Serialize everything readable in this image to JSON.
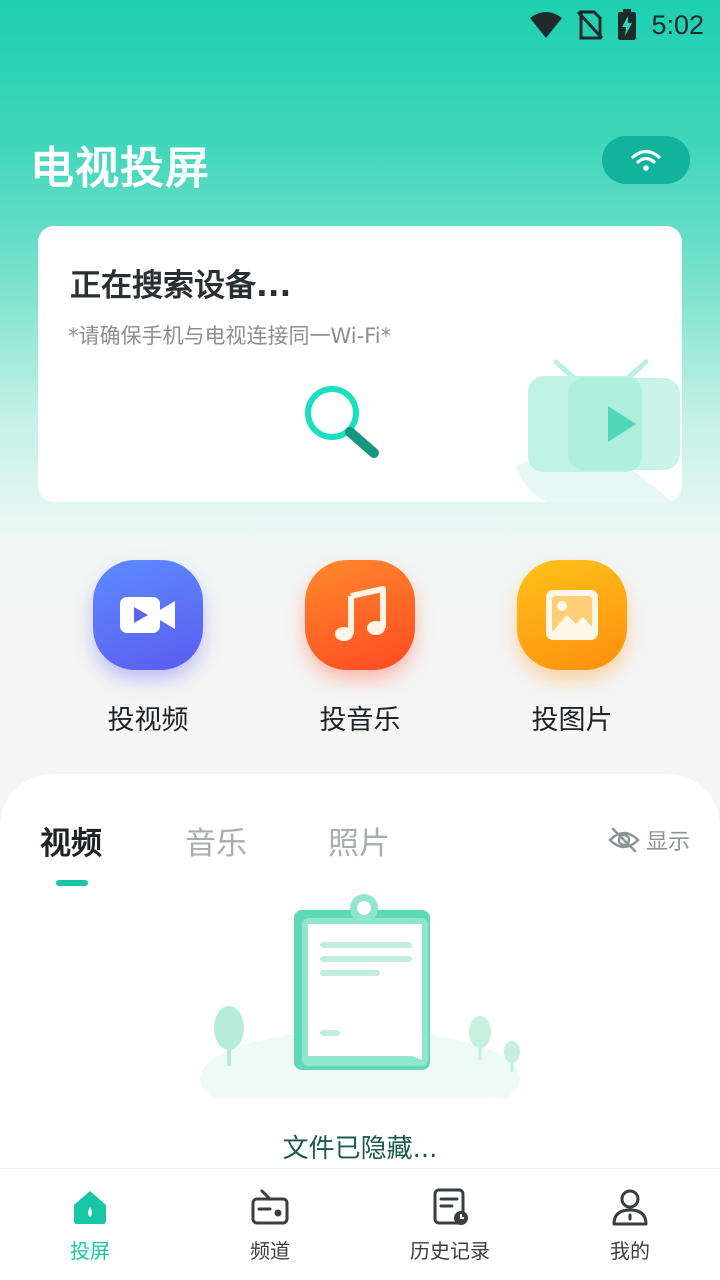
{
  "status_bar": {
    "time": "5:02"
  },
  "header": {
    "title": "电视投屏"
  },
  "search_card": {
    "title": "正在搜索设备...",
    "hint": "*请确保手机与电视连接同一Wi-Fi*"
  },
  "actions": [
    {
      "label": "投视频",
      "icon": "video-camera-icon",
      "color": "#5b6ef7"
    },
    {
      "label": "投音乐",
      "icon": "music-note-icon",
      "color": "#ff6a2a"
    },
    {
      "label": "投图片",
      "icon": "image-icon",
      "color": "#ffa812"
    }
  ],
  "media_tabs": {
    "tabs": [
      "视频",
      "音乐",
      "照片"
    ],
    "active_index": 0,
    "show_toggle": "显示"
  },
  "empty_state": {
    "message": "文件已隐藏..."
  },
  "bottom_nav": {
    "items": [
      "投屏",
      "频道",
      "历史记录",
      "我的"
    ],
    "active_index": 0
  },
  "colors": {
    "accent": "#16c6a5",
    "header_top": "#1ecfb0"
  }
}
